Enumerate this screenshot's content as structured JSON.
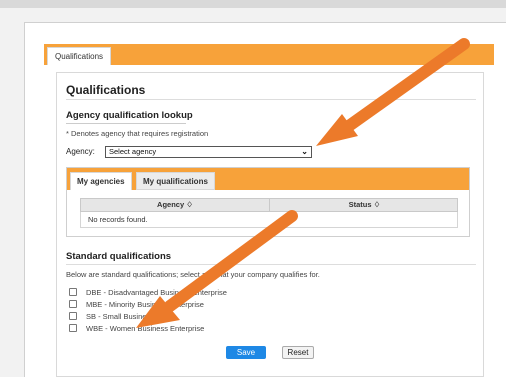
{
  "tabs": {
    "main_tab": "Qualifications"
  },
  "qualifications": {
    "title": "Qualifications",
    "lookup_title": "Agency qualification lookup",
    "registration_note": "* Denotes agency that requires registration",
    "agency_label": "Agency:",
    "agency_select_value": "Select agency",
    "inner_tabs": [
      "My agencies",
      "My qualifications"
    ],
    "grid": {
      "columns": [
        "Agency ♢",
        "Status ♢"
      ],
      "empty_message": "No records found."
    }
  },
  "standard": {
    "title": "Standard qualifications",
    "note": "Below are standard qualifications; select any that your company qualifies for.",
    "items": [
      "DBE - Disadvantaged Business Enterprise",
      "MBE - Minority Business Enterprise",
      "SB - Small Business",
      "WBE - Women Business Enterprise"
    ]
  },
  "buttons": {
    "save": "Save",
    "reset": "Reset"
  },
  "colors": {
    "accent_orange": "#f7a23a",
    "arrow_orange": "#ec7a2a",
    "save_blue": "#1e88e5"
  }
}
